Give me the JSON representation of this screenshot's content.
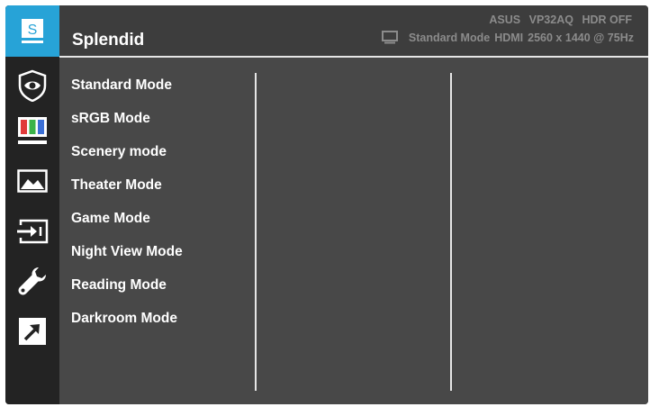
{
  "sidebar": {
    "active_label": "S",
    "items": [
      {
        "name": "splendid-icon",
        "active": true
      },
      {
        "name": "eye-care-icon"
      },
      {
        "name": "color-bars-icon"
      },
      {
        "name": "image-icon"
      },
      {
        "name": "input-select-icon"
      },
      {
        "name": "wrench-icon"
      },
      {
        "name": "shortcut-icon"
      }
    ]
  },
  "header": {
    "title": "Splendid",
    "brand": "ASUS",
    "model": "VP32AQ",
    "hdr_status": "HDR OFF",
    "mode": "Standard Mode",
    "input": "HDMI",
    "resolution": "2560 x 1440 @ 75Hz"
  },
  "menu": {
    "items": [
      "Standard Mode",
      "sRGB Mode",
      "Scenery mode",
      "Theater Mode",
      "Game Mode",
      "Night View Mode",
      "Reading Mode",
      "Darkroom Mode"
    ]
  },
  "colors": {
    "accent": "#27a3d7",
    "sidebar_bg": "#232323",
    "panel_bg": "#484848",
    "header_bg": "#3d3d3d",
    "text": "#ffffff",
    "status_text": "#8b8b8b"
  }
}
